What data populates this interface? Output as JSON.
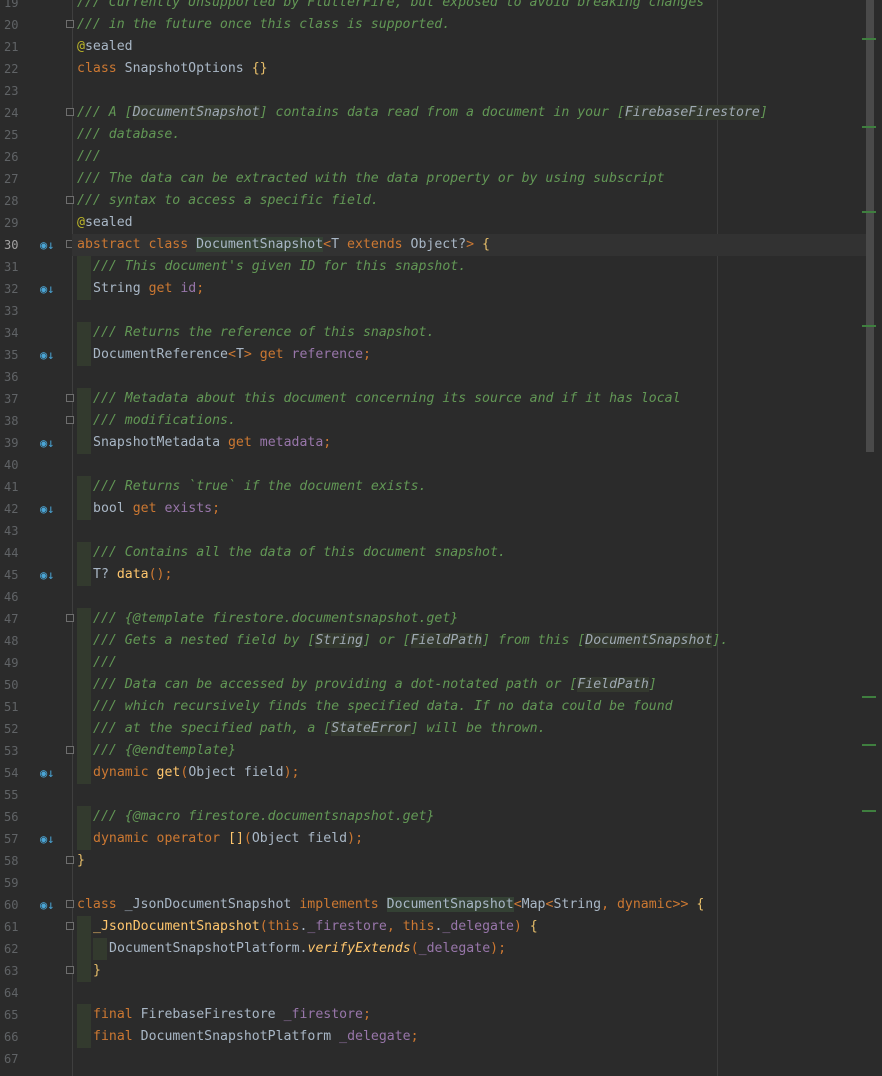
{
  "editor": {
    "current_line": 30,
    "lines": [
      {
        "n": 19,
        "impl": false,
        "fold": false,
        "segs": [
          [
            "/// Currently Unsupported by FlutterFire, but exposed to avoid breaking changes",
            "doc"
          ]
        ]
      },
      {
        "n": 20,
        "impl": false,
        "fold": true,
        "segs": [
          [
            "/// in the future once this class is supported.",
            "doc"
          ]
        ]
      },
      {
        "n": 21,
        "impl": false,
        "fold": false,
        "segs": [
          [
            "@",
            "ann"
          ],
          [
            "sealed",
            "plain"
          ]
        ]
      },
      {
        "n": 22,
        "impl": false,
        "fold": false,
        "segs": [
          [
            "class ",
            "kw"
          ],
          [
            "SnapshotOptions ",
            "plain"
          ],
          [
            "{}",
            "brace"
          ]
        ]
      },
      {
        "n": 23,
        "impl": false,
        "fold": false,
        "segs": []
      },
      {
        "n": 24,
        "impl": false,
        "fold": true,
        "segs": [
          [
            "/// A [",
            "doc"
          ],
          [
            "DocumentSnapshot",
            "ref"
          ],
          [
            "] contains data read from a document in your [",
            "doc"
          ],
          [
            "FirebaseFirestore",
            "ref"
          ],
          [
            "]",
            "doc"
          ]
        ]
      },
      {
        "n": 25,
        "impl": false,
        "fold": false,
        "segs": [
          [
            "/// database.",
            "doc"
          ]
        ]
      },
      {
        "n": 26,
        "impl": false,
        "fold": false,
        "segs": [
          [
            "///",
            "doc"
          ]
        ]
      },
      {
        "n": 27,
        "impl": false,
        "fold": false,
        "segs": [
          [
            "/// The data can be extracted with the data property or by using subscript",
            "doc"
          ]
        ]
      },
      {
        "n": 28,
        "impl": false,
        "fold": true,
        "segs": [
          [
            "/// syntax to access a specific field.",
            "doc"
          ]
        ]
      },
      {
        "n": 29,
        "impl": false,
        "fold": false,
        "segs": [
          [
            "@",
            "ann"
          ],
          [
            "sealed",
            "plain"
          ]
        ]
      },
      {
        "n": 30,
        "impl": true,
        "fold": true,
        "segs": [
          [
            "abstract ",
            "kw"
          ],
          [
            "class ",
            "kw"
          ],
          [
            "DocumentSnapshot",
            "hl"
          ],
          [
            "<",
            "punc"
          ],
          [
            "T ",
            "plain"
          ],
          [
            "extends ",
            "kw"
          ],
          [
            "Object?",
            "plain"
          ],
          [
            "> ",
            "punc"
          ],
          [
            "{",
            "brace"
          ]
        ]
      },
      {
        "n": 31,
        "impl": false,
        "fold": false,
        "indent": 1,
        "bar": true,
        "segs": [
          [
            "/// This document's given ID for this snapshot.",
            "doc"
          ]
        ]
      },
      {
        "n": 32,
        "impl": true,
        "fold": false,
        "indent": 1,
        "bar": true,
        "segs": [
          [
            "String ",
            "plain"
          ],
          [
            "get ",
            "kw"
          ],
          [
            "id",
            "field"
          ],
          [
            ";",
            "punc"
          ]
        ]
      },
      {
        "n": 33,
        "impl": false,
        "fold": false,
        "segs": []
      },
      {
        "n": 34,
        "impl": false,
        "fold": false,
        "indent": 1,
        "bar": true,
        "segs": [
          [
            "/// Returns the reference of this snapshot.",
            "doc"
          ]
        ]
      },
      {
        "n": 35,
        "impl": true,
        "fold": false,
        "indent": 1,
        "bar": true,
        "segs": [
          [
            "DocumentReference",
            "plain"
          ],
          [
            "<",
            "punc"
          ],
          [
            "T",
            "plain"
          ],
          [
            "> ",
            "punc"
          ],
          [
            "get ",
            "kw"
          ],
          [
            "reference",
            "field"
          ],
          [
            ";",
            "punc"
          ]
        ]
      },
      {
        "n": 36,
        "impl": false,
        "fold": false,
        "segs": []
      },
      {
        "n": 37,
        "impl": false,
        "fold": true,
        "indent": 1,
        "bar": true,
        "segs": [
          [
            "/// Metadata about this document concerning its source and if it has local",
            "doc"
          ]
        ]
      },
      {
        "n": 38,
        "impl": false,
        "fold": true,
        "indent": 1,
        "bar": true,
        "segs": [
          [
            "/// modifications.",
            "doc"
          ]
        ]
      },
      {
        "n": 39,
        "impl": true,
        "fold": false,
        "indent": 1,
        "bar": true,
        "segs": [
          [
            "SnapshotMetadata ",
            "plain"
          ],
          [
            "get ",
            "kw"
          ],
          [
            "metadata",
            "field"
          ],
          [
            ";",
            "punc"
          ]
        ]
      },
      {
        "n": 40,
        "impl": false,
        "fold": false,
        "segs": []
      },
      {
        "n": 41,
        "impl": false,
        "fold": false,
        "indent": 1,
        "bar": true,
        "segs": [
          [
            "/// Returns `true` if the document exists.",
            "doc"
          ]
        ]
      },
      {
        "n": 42,
        "impl": true,
        "fold": false,
        "indent": 1,
        "bar": true,
        "segs": [
          [
            "bool ",
            "plain"
          ],
          [
            "get ",
            "kw"
          ],
          [
            "exists",
            "field"
          ],
          [
            ";",
            "punc"
          ]
        ]
      },
      {
        "n": 43,
        "impl": false,
        "fold": false,
        "segs": []
      },
      {
        "n": 44,
        "impl": false,
        "fold": false,
        "indent": 1,
        "bar": true,
        "segs": [
          [
            "/// Contains all the data of this document snapshot.",
            "doc"
          ]
        ]
      },
      {
        "n": 45,
        "impl": true,
        "fold": false,
        "indent": 1,
        "bar": true,
        "segs": [
          [
            "T? ",
            "plain"
          ],
          [
            "data",
            "fn"
          ],
          [
            "();",
            "punc"
          ]
        ]
      },
      {
        "n": 46,
        "impl": false,
        "fold": false,
        "segs": []
      },
      {
        "n": 47,
        "impl": false,
        "fold": true,
        "indent": 1,
        "bar": true,
        "segs": [
          [
            "/// {@template firestore.documentsnapshot.get}",
            "doc"
          ]
        ]
      },
      {
        "n": 48,
        "impl": false,
        "fold": false,
        "indent": 1,
        "bar": true,
        "segs": [
          [
            "/// Gets a nested field by [",
            "doc"
          ],
          [
            "String",
            "ref"
          ],
          [
            "] or [",
            "doc"
          ],
          [
            "FieldPath",
            "ref"
          ],
          [
            "] from this [",
            "doc"
          ],
          [
            "DocumentSnapshot",
            "ref"
          ],
          [
            "].",
            "doc"
          ]
        ]
      },
      {
        "n": 49,
        "impl": false,
        "fold": false,
        "indent": 1,
        "bar": true,
        "segs": [
          [
            "///",
            "doc"
          ]
        ]
      },
      {
        "n": 50,
        "impl": false,
        "fold": false,
        "indent": 1,
        "bar": true,
        "segs": [
          [
            "/// Data can be accessed by providing a dot-notated path or [",
            "doc"
          ],
          [
            "FieldPath",
            "ref"
          ],
          [
            "]",
            "doc"
          ]
        ]
      },
      {
        "n": 51,
        "impl": false,
        "fold": false,
        "indent": 1,
        "bar": true,
        "segs": [
          [
            "/// which recursively finds the specified data. If no data could be found",
            "doc"
          ]
        ]
      },
      {
        "n": 52,
        "impl": false,
        "fold": false,
        "indent": 1,
        "bar": true,
        "segs": [
          [
            "/// at the specified path, a [",
            "doc"
          ],
          [
            "StateError",
            "ref"
          ],
          [
            "] will be thrown.",
            "doc"
          ]
        ]
      },
      {
        "n": 53,
        "impl": false,
        "fold": true,
        "indent": 1,
        "bar": true,
        "segs": [
          [
            "/// {@endtemplate}",
            "doc"
          ]
        ]
      },
      {
        "n": 54,
        "impl": true,
        "fold": false,
        "indent": 1,
        "bar": true,
        "segs": [
          [
            "dynamic ",
            "kw"
          ],
          [
            "get",
            "fn"
          ],
          [
            "(",
            "punc"
          ],
          [
            "Object field",
            "plain"
          ],
          [
            ");",
            "punc"
          ]
        ]
      },
      {
        "n": 55,
        "impl": false,
        "fold": false,
        "segs": []
      },
      {
        "n": 56,
        "impl": false,
        "fold": false,
        "indent": 1,
        "bar": true,
        "segs": [
          [
            "/// {@macro firestore.documentsnapshot.get}",
            "doc"
          ]
        ]
      },
      {
        "n": 57,
        "impl": true,
        "fold": false,
        "indent": 1,
        "bar": true,
        "segs": [
          [
            "dynamic ",
            "kw"
          ],
          [
            "operator ",
            "kw"
          ],
          [
            "[]",
            "fn"
          ],
          [
            "(",
            "punc"
          ],
          [
            "Object field",
            "plain"
          ],
          [
            ");",
            "punc"
          ]
        ]
      },
      {
        "n": 58,
        "impl": false,
        "fold": true,
        "segs": [
          [
            "}",
            "brace"
          ]
        ]
      },
      {
        "n": 59,
        "impl": false,
        "fold": false,
        "segs": []
      },
      {
        "n": 60,
        "impl": true,
        "fold": true,
        "segs": [
          [
            "class ",
            "kw"
          ],
          [
            "_JsonDocumentSnapshot ",
            "plain"
          ],
          [
            "implements ",
            "kw"
          ],
          [
            "DocumentSnapshot",
            "hl"
          ],
          [
            "<",
            "punc"
          ],
          [
            "Map",
            "plain"
          ],
          [
            "<",
            "punc"
          ],
          [
            "String",
            "plain"
          ],
          [
            ", ",
            "punc"
          ],
          [
            "dynamic",
            "kw"
          ],
          [
            ">> ",
            "punc"
          ],
          [
            "{",
            "brace"
          ]
        ]
      },
      {
        "n": 61,
        "impl": false,
        "fold": true,
        "indent": 1,
        "bar": true,
        "segs": [
          [
            "_JsonDocumentSnapshot",
            "fn"
          ],
          [
            "(",
            "punc"
          ],
          [
            "this",
            "kw"
          ],
          [
            ".",
            "plain"
          ],
          [
            "_firestore",
            "field"
          ],
          [
            ", ",
            "punc"
          ],
          [
            "this",
            "kw"
          ],
          [
            ".",
            "plain"
          ],
          [
            "_delegate",
            "field"
          ],
          [
            ") ",
            "punc"
          ],
          [
            "{",
            "brace"
          ]
        ]
      },
      {
        "n": 62,
        "impl": false,
        "fold": false,
        "indent": 2,
        "bar": true,
        "segs": [
          [
            "DocumentSnapshotPlatform.",
            "plain"
          ],
          [
            "verifyExtends",
            "fni"
          ],
          [
            "(",
            "punc"
          ],
          [
            "_delegate",
            "field"
          ],
          [
            ");",
            "punc"
          ]
        ]
      },
      {
        "n": 63,
        "impl": false,
        "fold": true,
        "indent": 1,
        "bar": true,
        "segs": [
          [
            "}",
            "brace"
          ]
        ]
      },
      {
        "n": 64,
        "impl": false,
        "fold": false,
        "segs": []
      },
      {
        "n": 65,
        "impl": false,
        "fold": false,
        "indent": 1,
        "bar": true,
        "segs": [
          [
            "final ",
            "kw"
          ],
          [
            "FirebaseFirestore ",
            "plain"
          ],
          [
            "_firestore",
            "field"
          ],
          [
            ";",
            "punc"
          ]
        ]
      },
      {
        "n": 66,
        "impl": false,
        "fold": false,
        "indent": 1,
        "bar": true,
        "segs": [
          [
            "final ",
            "kw"
          ],
          [
            "DocumentSnapshotPlatform ",
            "plain"
          ],
          [
            "_delegate",
            "field"
          ],
          [
            ";",
            "punc"
          ]
        ]
      },
      {
        "n": 67,
        "impl": false,
        "fold": false,
        "segs": []
      }
    ]
  },
  "colors": {
    "background": "#2b2b2b",
    "doc_comment": "#629755",
    "keyword": "#cc7832",
    "annotation": "#bbb529",
    "function": "#ffc66d",
    "field": "#9876aa",
    "plain": "#a9b7c6",
    "line_number": "#606366",
    "implementation_icon": "#4aa5d6"
  }
}
